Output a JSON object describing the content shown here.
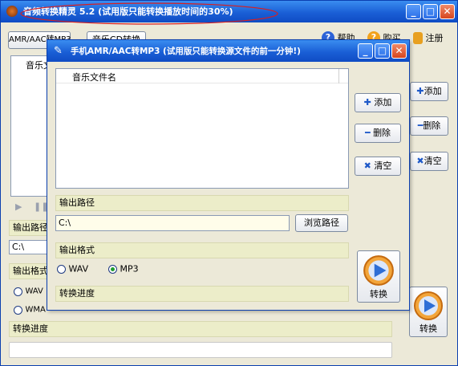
{
  "main": {
    "title": "音频转换精灵 5.2 (试用版只能转换播放时间的30%)",
    "header_tab1": "AMR/AAC转MP3",
    "header_tab2": "音乐CD转换",
    "help": "帮助",
    "buy": "购买",
    "register": "注册",
    "list_header": "音乐文",
    "add": "添加",
    "delete": "删除",
    "clear": "清空",
    "output_path_label": "输出路径",
    "output_path_value": "C:\\",
    "output_format_label": "输出格式",
    "opt_wav": "WAV",
    "opt_wma": "WMA",
    "progress_label": "转换进度",
    "convert": "转换"
  },
  "dialog": {
    "title": "手机AMR/AAC转MP3 (试用版只能转换源文件的前一分钟!)",
    "list_header": "音乐文件名",
    "add": "添加",
    "delete": "删除",
    "clear": "清空",
    "output_path_label": "输出路径",
    "output_path_value": "C:\\",
    "browse": "浏览路径",
    "output_format_label": "输出格式",
    "format_options": [
      {
        "label": "WAV",
        "selected": false
      },
      {
        "label": "MP3",
        "selected": true
      }
    ],
    "progress_label": "转换进度",
    "convert": "转换"
  },
  "colors": {
    "titlebar": "#1a5fd6",
    "band": "#ecedc9",
    "accent_blue": "#1d58c8",
    "annotation_red": "#d91f1f"
  }
}
